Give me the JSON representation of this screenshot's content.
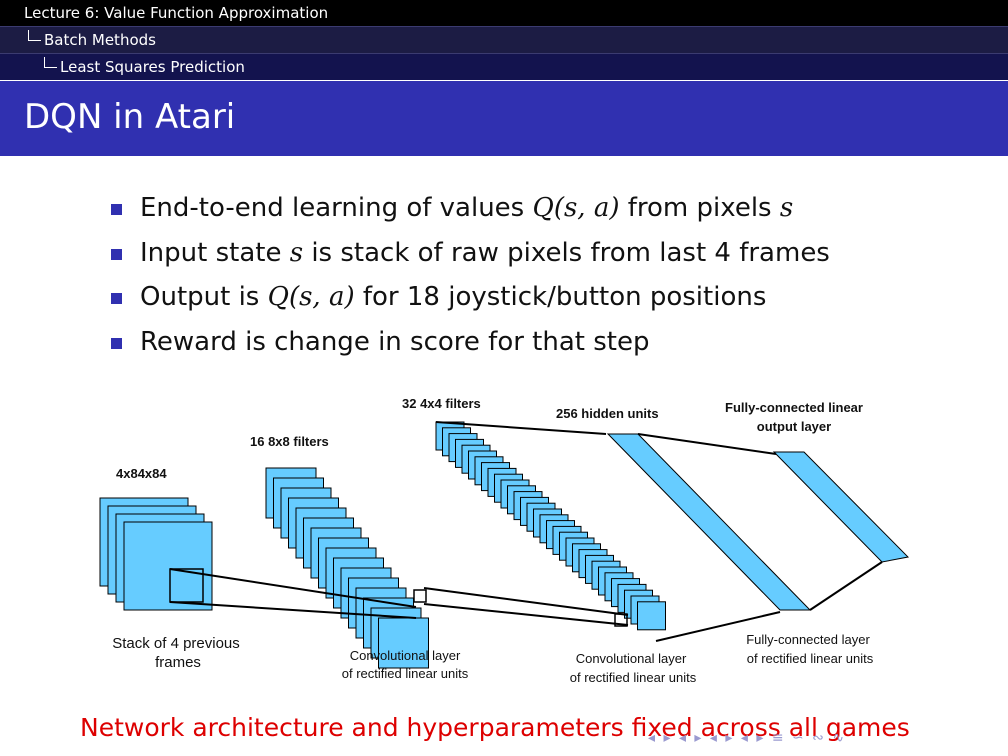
{
  "header": {
    "section": "Lecture 6: Value Function Approximation",
    "subsection": "Batch Methods",
    "subsubsection": "Least Squares Prediction"
  },
  "slide": {
    "title": "DQN in Atari",
    "bullets": [
      {
        "before": "End-to-end learning of values ",
        "math": "Q(s, a)",
        "after": " from pixels ",
        "math2": "s"
      },
      {
        "before": "Input state ",
        "math": "s",
        "after": " is stack of raw pixels from last 4 frames",
        "math2": ""
      },
      {
        "before": "Output is ",
        "math": "Q(s, a)",
        "after": " for 18 joystick/button positions",
        "math2": ""
      },
      {
        "before": "Reward is change in score for that step",
        "math": "",
        "after": "",
        "math2": ""
      }
    ],
    "caption": "Network architecture and hyperparameters fixed across all games"
  },
  "diagram": {
    "labels": {
      "input_dims": "4x84x84",
      "conv1_filters": "16 8x8 filters",
      "conv2_filters": "32 4x4 filters",
      "hidden_units": "256 hidden units",
      "output_layer_line1": "Fully-connected linear",
      "output_layer_line2": "output layer",
      "stack_line1": "Stack of 4 previous",
      "stack_line2": "frames",
      "conv1_line1": "Convolutional layer",
      "conv1_line2": "of rectified linear units",
      "conv2_line1": "Convolutional layer",
      "conv2_line2": "of rectified linear units",
      "fc_line1": "Fully-connected layer",
      "fc_line2": "of rectified linear units"
    },
    "colors": {
      "fill": "#66ccff",
      "stroke": "#000000"
    }
  },
  "nav": {
    "symbols": "◂ ▸ ◂ ▸ ◂ ▸ ◂ ▸  ≡  ∽ ∾ ∿"
  }
}
